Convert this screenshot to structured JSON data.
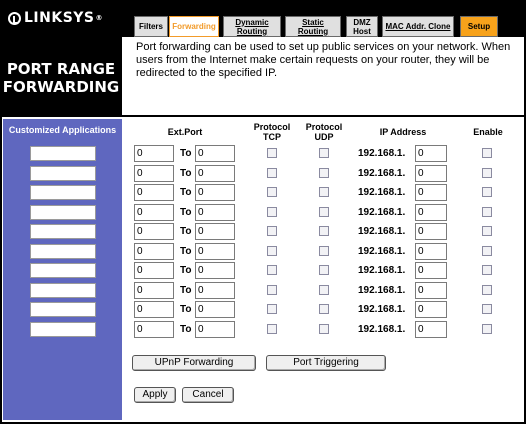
{
  "brand": {
    "name": "LINKSYS",
    "trademark": "®"
  },
  "tabs": [
    "Filters",
    "Forwarding",
    "Dynamic Routing",
    "Static Routing",
    "DMZ Host",
    "MAC Addr. Clone",
    "Setup"
  ],
  "page_title": [
    "PORT RANGE",
    "FORWARDING"
  ],
  "intro_text": "Port forwarding can be used to set up public services on your network. When users from the Internet make certain requests on your router, they will be redirected to the specified IP.",
  "sidebar_title": "Customized Applications",
  "columns": {
    "ext_port": "Ext.Port",
    "protocol_tcp": [
      "Protocol",
      "TCP"
    ],
    "protocol_udp": [
      "Protocol",
      "UDP"
    ],
    "ip_address": "IP Address",
    "enable": "Enable"
  },
  "rows": [
    {
      "app": "",
      "start": "0",
      "end": "0",
      "to": "To",
      "ip_prefix": "192.168.1.",
      "ip_last": "0",
      "tcp": false,
      "udp": false,
      "enable": false
    },
    {
      "app": "",
      "start": "0",
      "end": "0",
      "to": "To",
      "ip_prefix": "192.168.1.",
      "ip_last": "0",
      "tcp": false,
      "udp": false,
      "enable": false
    },
    {
      "app": "",
      "start": "0",
      "end": "0",
      "to": "To",
      "ip_prefix": "192.168.1.",
      "ip_last": "0",
      "tcp": false,
      "udp": false,
      "enable": false
    },
    {
      "app": "",
      "start": "0",
      "end": "0",
      "to": "To",
      "ip_prefix": "192.168.1.",
      "ip_last": "0",
      "tcp": false,
      "udp": false,
      "enable": false
    },
    {
      "app": "",
      "start": "0",
      "end": "0",
      "to": "To",
      "ip_prefix": "192.168.1.",
      "ip_last": "0",
      "tcp": false,
      "udp": false,
      "enable": false
    },
    {
      "app": "",
      "start": "0",
      "end": "0",
      "to": "To",
      "ip_prefix": "192.168.1.",
      "ip_last": "0",
      "tcp": false,
      "udp": false,
      "enable": false
    },
    {
      "app": "",
      "start": "0",
      "end": "0",
      "to": "To",
      "ip_prefix": "192.168.1.",
      "ip_last": "0",
      "tcp": false,
      "udp": false,
      "enable": false
    },
    {
      "app": "",
      "start": "0",
      "end": "0",
      "to": "To",
      "ip_prefix": "192.168.1.",
      "ip_last": "0",
      "tcp": false,
      "udp": false,
      "enable": false
    },
    {
      "app": "",
      "start": "0",
      "end": "0",
      "to": "To",
      "ip_prefix": "192.168.1.",
      "ip_last": "0",
      "tcp": false,
      "udp": false,
      "enable": false
    },
    {
      "app": "",
      "start": "0",
      "end": "0",
      "to": "To",
      "ip_prefix": "192.168.1.",
      "ip_last": "0",
      "tcp": false,
      "udp": false,
      "enable": false
    }
  ],
  "buttons": {
    "upnp": "UPnP Forwarding",
    "triggering": "Port Triggering",
    "apply": "Apply",
    "cancel": "Cancel"
  },
  "colors": {
    "accent_orange": "#f29b2a",
    "sidebar_blue": "#5f67bf",
    "header_black": "#000000"
  }
}
